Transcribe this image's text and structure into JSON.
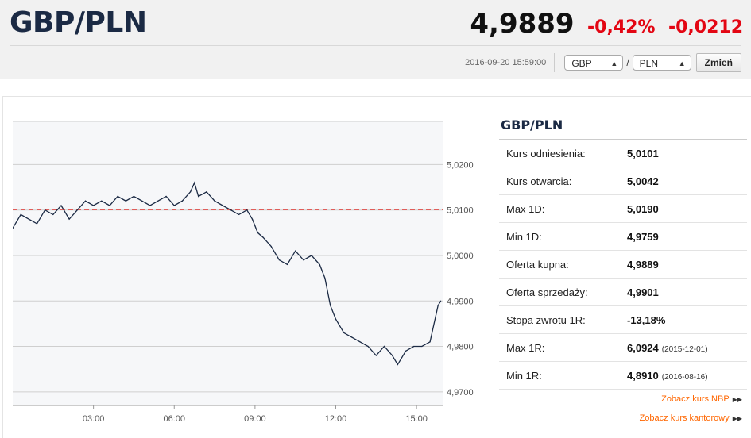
{
  "header": {
    "title": "GBP/PLN",
    "price": "4,9889",
    "change_pct": "-0,42%",
    "change_abs": "-0,0212",
    "timestamp": "2016-09-20 15:59:00",
    "from_currency": "GBP",
    "to_currency": "PLN",
    "change_button": "Zmień",
    "colors": {
      "negative": "#e30613",
      "title": "#1b2a44"
    }
  },
  "chart_data": {
    "type": "line",
    "x_ticks": [
      "03:00",
      "06:00",
      "09:00",
      "12:00",
      "15:00"
    ],
    "y_ticks": [
      "5,0200",
      "5,0100",
      "5,0000",
      "4,9900",
      "4,9800",
      "4,9700"
    ],
    "y_tick_values": [
      5.02,
      5.01,
      5.0,
      4.99,
      4.98,
      4.97
    ],
    "ylim": [
      4.967,
      5.0295
    ],
    "xlim": [
      0,
      16
    ],
    "reference_line": 5.0101,
    "reference_color": "#e53935",
    "series": [
      {
        "x": [
          0,
          0.3,
          0.6,
          0.9,
          1.2,
          1.5,
          1.8,
          2.1,
          2.4,
          2.7,
          3.0,
          3.3,
          3.6,
          3.9,
          4.2,
          4.5,
          4.8,
          5.1,
          5.4,
          5.7,
          6.0,
          6.3,
          6.6,
          6.75,
          6.9,
          7.2,
          7.5,
          7.8,
          8.1,
          8.4,
          8.7,
          8.9,
          9.1,
          9.3,
          9.6,
          9.9,
          10.2,
          10.5,
          10.8,
          11.1,
          11.4,
          11.6,
          11.8,
          12.0,
          12.3,
          12.6,
          12.9,
          13.2,
          13.5,
          13.8,
          14.1,
          14.3,
          14.6,
          14.9,
          15.2,
          15.5,
          15.8,
          15.9
        ],
        "y": [
          5.006,
          5.009,
          5.008,
          5.007,
          5.01,
          5.009,
          5.011,
          5.008,
          5.01,
          5.012,
          5.011,
          5.012,
          5.011,
          5.013,
          5.012,
          5.013,
          5.012,
          5.011,
          5.012,
          5.013,
          5.011,
          5.012,
          5.014,
          5.016,
          5.013,
          5.014,
          5.012,
          5.011,
          5.01,
          5.009,
          5.01,
          5.008,
          5.005,
          5.004,
          5.002,
          4.999,
          4.998,
          5.001,
          4.999,
          5.0,
          4.998,
          4.995,
          4.989,
          4.986,
          4.983,
          4.982,
          4.981,
          4.98,
          4.978,
          4.98,
          4.978,
          4.976,
          4.979,
          4.98,
          4.98,
          4.981,
          4.989,
          4.99
        ]
      }
    ]
  },
  "sidebar": {
    "title": "GBP/PLN",
    "rows": [
      {
        "label": "Kurs odniesienia:",
        "value": "5,0101",
        "date": ""
      },
      {
        "label": "Kurs otwarcia:",
        "value": "5,0042",
        "date": ""
      },
      {
        "label": "Max 1D:",
        "value": "5,0190",
        "date": ""
      },
      {
        "label": "Min 1D:",
        "value": "4,9759",
        "date": ""
      },
      {
        "label": "Oferta kupna:",
        "value": "4,9889",
        "date": ""
      },
      {
        "label": "Oferta sprzedaży:",
        "value": "4,9901",
        "date": ""
      },
      {
        "label": "Stopa zwrotu 1R:",
        "value": "-13,18%",
        "date": ""
      },
      {
        "label": "Max 1R:",
        "value": "6,0924",
        "date": "(2015-12-01)"
      },
      {
        "label": "Min 1R:",
        "value": "4,8910",
        "date": "(2016-08-16)"
      }
    ],
    "links": [
      {
        "label": "Zobacz kurs NBP",
        "icon": "double-chevron-right-icon"
      },
      {
        "label": "Zobacz kurs kantorowy",
        "icon": "double-chevron-right-icon"
      }
    ],
    "link_color": "#ff6600"
  }
}
